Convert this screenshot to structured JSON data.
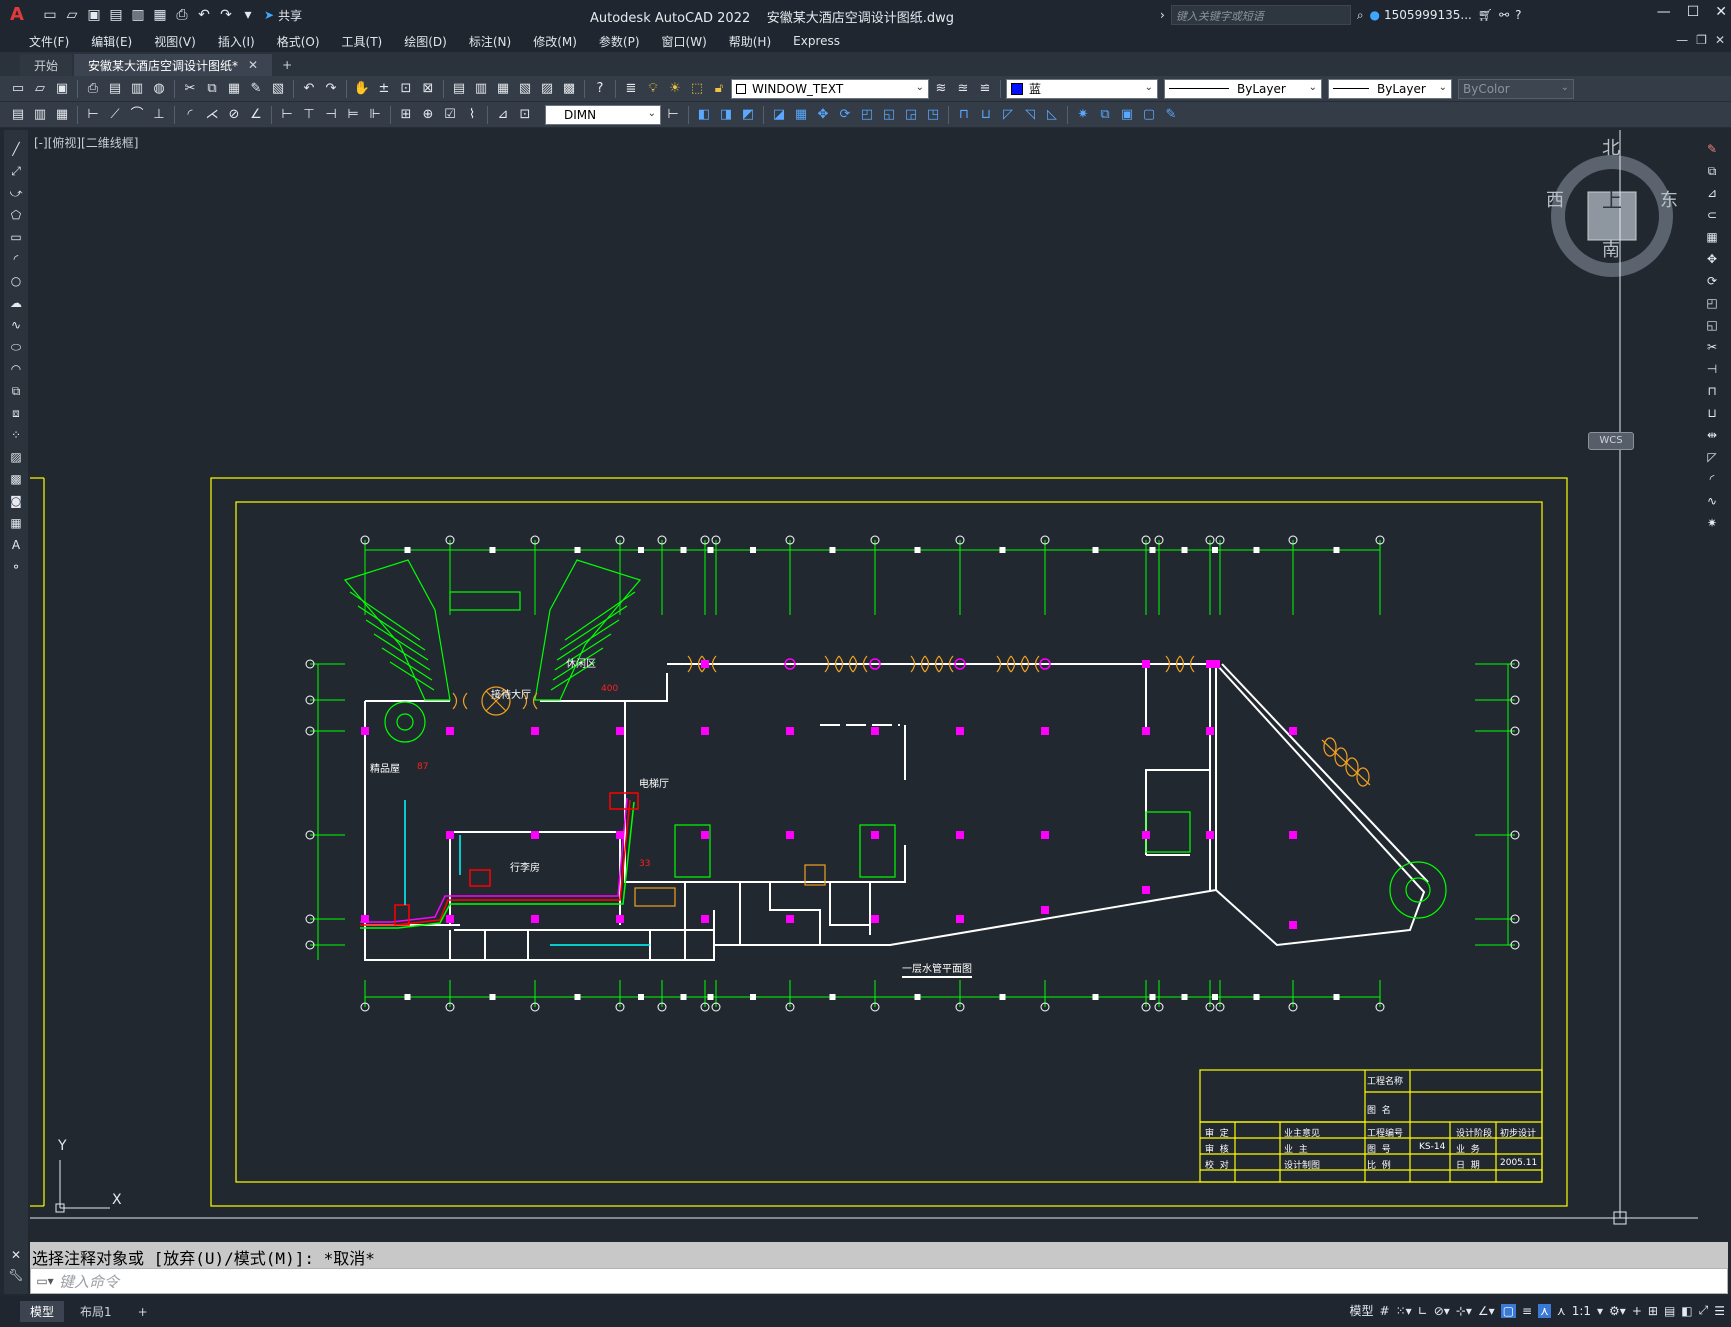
{
  "titlebar": {
    "app_name": "Autodesk AutoCAD 2022",
    "file_name": "安徽某大酒店空调设计图纸.dwg",
    "share_label": "共享",
    "search_placeholder": "键入关键字或短语",
    "user": "1505999135..."
  },
  "menu": [
    "文件(F)",
    "编辑(E)",
    "视图(V)",
    "插入(I)",
    "格式(O)",
    "工具(T)",
    "绘图(D)",
    "标注(N)",
    "修改(M)",
    "参数(P)",
    "窗口(W)",
    "帮助(H)",
    "Express"
  ],
  "tabs": {
    "start": "开始",
    "drawing": "安徽某大酒店空调设计图纸*"
  },
  "toolbar": {
    "layer_name": "WINDOW_TEXT",
    "color": "蓝",
    "linetype": "ByLayer",
    "lineweight": "ByLayer",
    "plotstyle": "ByColor",
    "dimstyle": "DIMN"
  },
  "viewport": {
    "label": "[-][俯视][二维线框]",
    "viewcube": {
      "north": "北",
      "south": "南",
      "east": "东",
      "west": "西",
      "top": "上",
      "wcs": "WCS"
    },
    "ucs_x": "X",
    "ucs_y": "Y"
  },
  "drawing": {
    "caption": "一层水管平面图",
    "rooms": {
      "lounge": "休闲区",
      "lobby": "接待大厅",
      "shop": "精品屋",
      "luggage": "行李房",
      "elevator_hall": "电梯厅",
      "val_400": "400",
      "val_87": "87",
      "val_33": "33"
    },
    "title_block": {
      "project_name": "工程名称",
      "drawing_name": "图  名",
      "reviewer": "审  定",
      "checker": "审  核",
      "proofreader": "校  对",
      "owner_opinion": "业主意见",
      "owner": "业  主",
      "design_drawing": "设计制图",
      "project_no": "工程编号",
      "drawing_no_label": "图  号",
      "drawing_no": "KS-14",
      "scale": "比  例",
      "design_stage": "设计阶段",
      "stage_value": "初步设计",
      "business": "业  务",
      "date_label": "日  期",
      "date": "2005.11"
    }
  },
  "command": {
    "history": "选择注释对象或 [放弃(U)/模式(M)]: *取消*",
    "placeholder": "键入命令"
  },
  "status": {
    "model_tab": "模型",
    "layout_tab": "布局1",
    "model_label": "模型",
    "scale": "1:1"
  },
  "colors": {
    "background": "#212830",
    "frame": "#ffff00",
    "axis": "#00ff00",
    "wall": "#ffffff",
    "column": "#ff00ff",
    "duct": "#ff0000",
    "equipment": "#00ffff",
    "stair": "#00ff00",
    "window": "#f0a020"
  }
}
